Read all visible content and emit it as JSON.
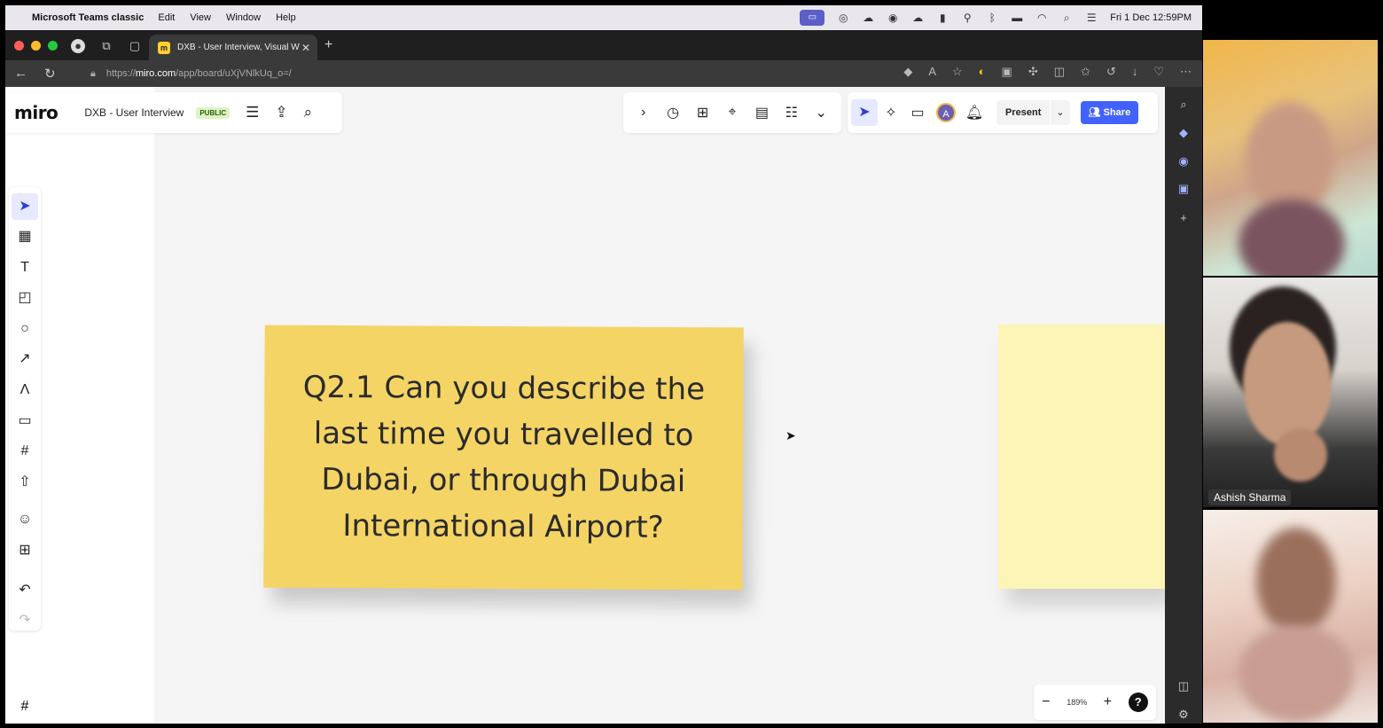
{
  "menubar": {
    "app": "Microsoft Teams classic",
    "menus": [
      "Edit",
      "View",
      "Window",
      "Help"
    ],
    "datetime": "Fri 1 Dec  12:59PM"
  },
  "browser": {
    "tab_title": "DXB - User Interview, Visual W",
    "url_prefix": "https://",
    "url_host": "miro.com",
    "url_path": "/app/board/uXjVNlkUq_o=/"
  },
  "miro": {
    "logo": "miro",
    "board_name": "DXB - User Interview",
    "visibility_badge": "PUBLIC",
    "avatar_initial": "A",
    "present_label": "Present",
    "share_label": "Share",
    "zoom_level": "189%",
    "help_label": "?"
  },
  "sticky_note": {
    "text": "Q2.1 Can you describe the last time you travelled to Dubai, or through Dubai International Airport?",
    "color": "#f4d465"
  },
  "participants": [
    {
      "name": ""
    },
    {
      "name": "Ashish Sharma"
    },
    {
      "name": ""
    }
  ]
}
